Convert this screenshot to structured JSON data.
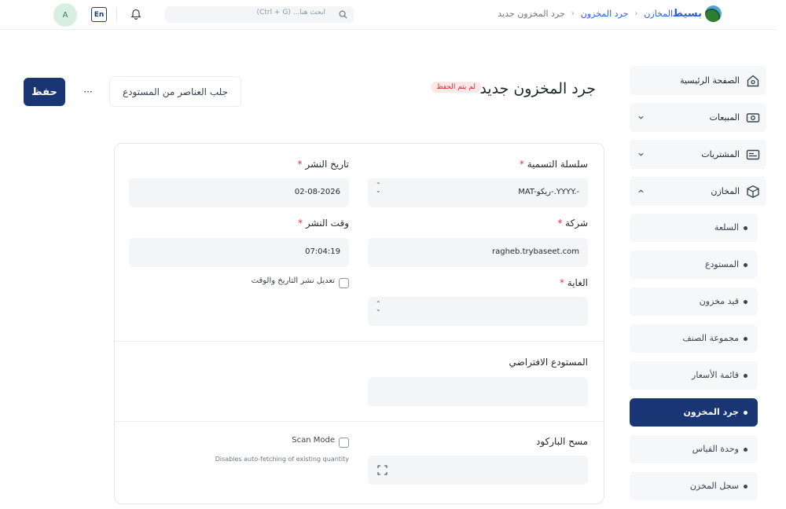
{
  "topbar": {
    "brand_name": "بسيط",
    "breadcrumbs": [
      "المخازن",
      "جرد المخزون",
      "جرد المخزون جديد"
    ],
    "search_placeholder": "ابحث هنا... (Ctrl + G)",
    "lang_label": "En",
    "avatar_initial": "A"
  },
  "sidebar": {
    "items": [
      {
        "label": "الصفحة الرئيسية",
        "icon": "home-icon"
      },
      {
        "label": "المبيعات",
        "icon": "sales-icon",
        "chevron": "down"
      },
      {
        "label": "المشتريات",
        "icon": "purchases-icon",
        "chevron": "down"
      },
      {
        "label": "المخازن",
        "icon": "box-icon",
        "chevron": "up"
      }
    ],
    "sub_items": [
      {
        "label": "السلعة"
      },
      {
        "label": "المستودع"
      },
      {
        "label": "قيد مخزون"
      },
      {
        "label": "مجموعة الصنف"
      },
      {
        "label": "قائمة الأسعار"
      },
      {
        "label": "جرد المخزون",
        "active": true
      },
      {
        "label": "وحدة القياس"
      },
      {
        "label": "سجل المخزن"
      }
    ]
  },
  "header": {
    "title": "جرد المخزون جديد",
    "status_badge": "لم يتم الحفظ",
    "save_label": "حفظ",
    "more_label": "···",
    "fetch_label": "جلب العناصر من المستودع"
  },
  "form": {
    "naming_series": {
      "label": "سلسلة التسمية",
      "value": "MAT-ريكو-.YYYY.-"
    },
    "company": {
      "label": "شركة",
      "value": "ragheb.trybaseet.com"
    },
    "purpose": {
      "label": "الغاية",
      "value": ""
    },
    "posting_date": {
      "label": "تاريخ النشر",
      "value": "02-08-2026"
    },
    "posting_time": {
      "label": "وقت النشر",
      "value": "07:04:19"
    },
    "edit_posting": {
      "label": "تعديل نشر التاريخ والوقت"
    },
    "default_warehouse": {
      "label": "المستودع الافتراضي",
      "value": ""
    },
    "scan_barcode": {
      "label": "مسح الباركود",
      "value": ""
    },
    "scan_mode": {
      "label": "Scan Mode",
      "hint": "Disables auto-fetching of existing quantity"
    }
  },
  "colors": {
    "primary": "#1a3573",
    "link": "#2b5fd9",
    "required": "#e03636",
    "badge_bg": "#fde8e8"
  }
}
